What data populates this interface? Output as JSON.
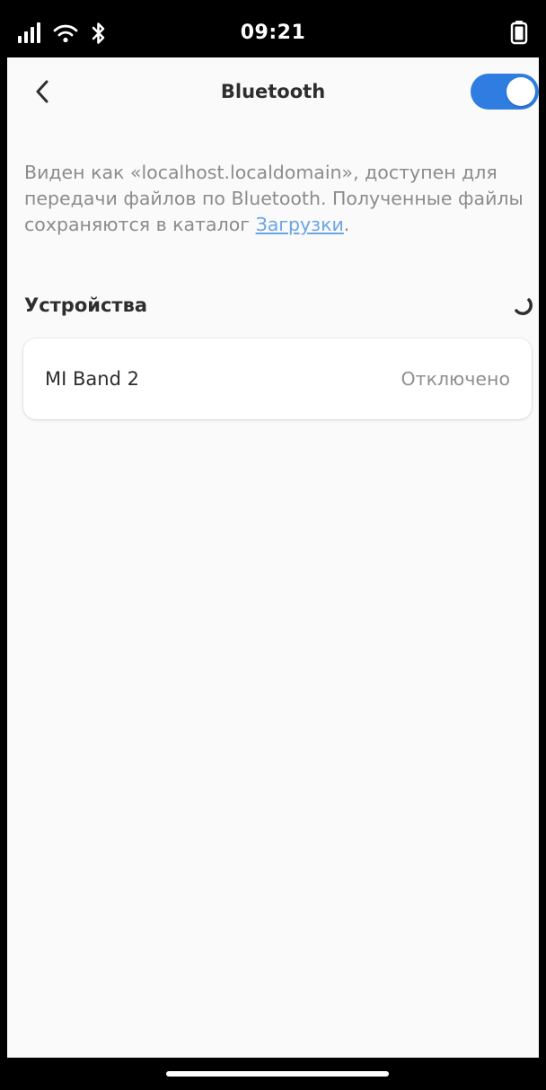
{
  "status_bar": {
    "time": "09:21",
    "icons": [
      "signal-icon",
      "wifi-icon",
      "bluetooth-icon",
      "battery-icon"
    ]
  },
  "header": {
    "back_icon": "chevron-left-icon",
    "title": "Bluetooth",
    "toggle_on": true
  },
  "description": {
    "text": "Виден как «localhost.localdomain», доступен для передачи файлов по Bluetooth. Полученные файлы сохраняются в каталог ",
    "link_label": "Загрузки",
    "suffix": "."
  },
  "devices": {
    "section_title": "Устройства",
    "loading_icon": "spinner-icon",
    "items": [
      {
        "name": "MI Band 2",
        "status": "Отключено"
      }
    ]
  },
  "colors": {
    "accent": "#2f7de1",
    "link": "#6aa5e4",
    "background": "#fafafa",
    "text_primary": "#2e2e2e",
    "text_secondary": "#8c8c8c"
  }
}
